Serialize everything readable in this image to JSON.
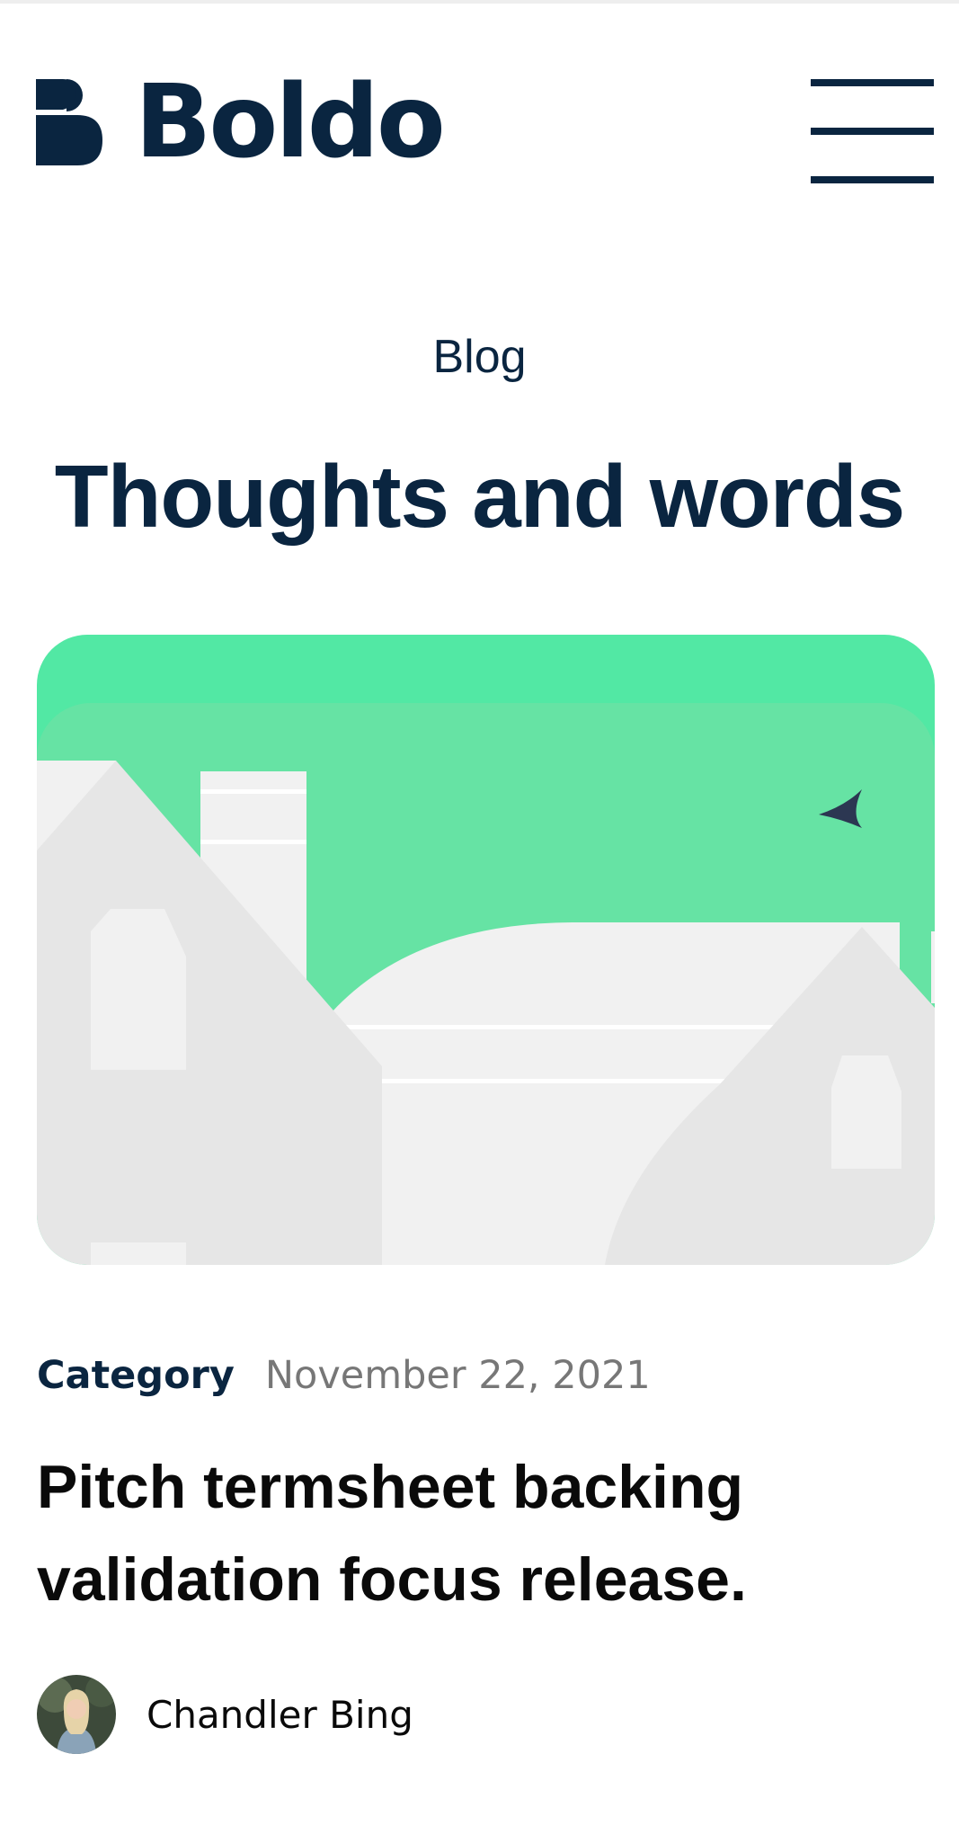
{
  "header": {
    "brand": "Boldo",
    "logo_icon": "boldo-b-mark",
    "menu_icon": "hamburger-menu-icon"
  },
  "section": {
    "eyebrow": "Blog",
    "title": "Thoughts and words"
  },
  "post": {
    "image_icon": "house-rooftops-illustration",
    "category": "Category",
    "date": "November 22, 2021",
    "title": "Pitch termsheet backing validation focus release.",
    "author": "Chandler Bing"
  },
  "colors": {
    "brand_navy": "#0a2540",
    "sky_green": "#66e3a4",
    "sky_green_top": "#52e8a4",
    "building_light": "#f1f1f1",
    "building_mid": "#e6e6e6",
    "date_gray": "#777777"
  }
}
